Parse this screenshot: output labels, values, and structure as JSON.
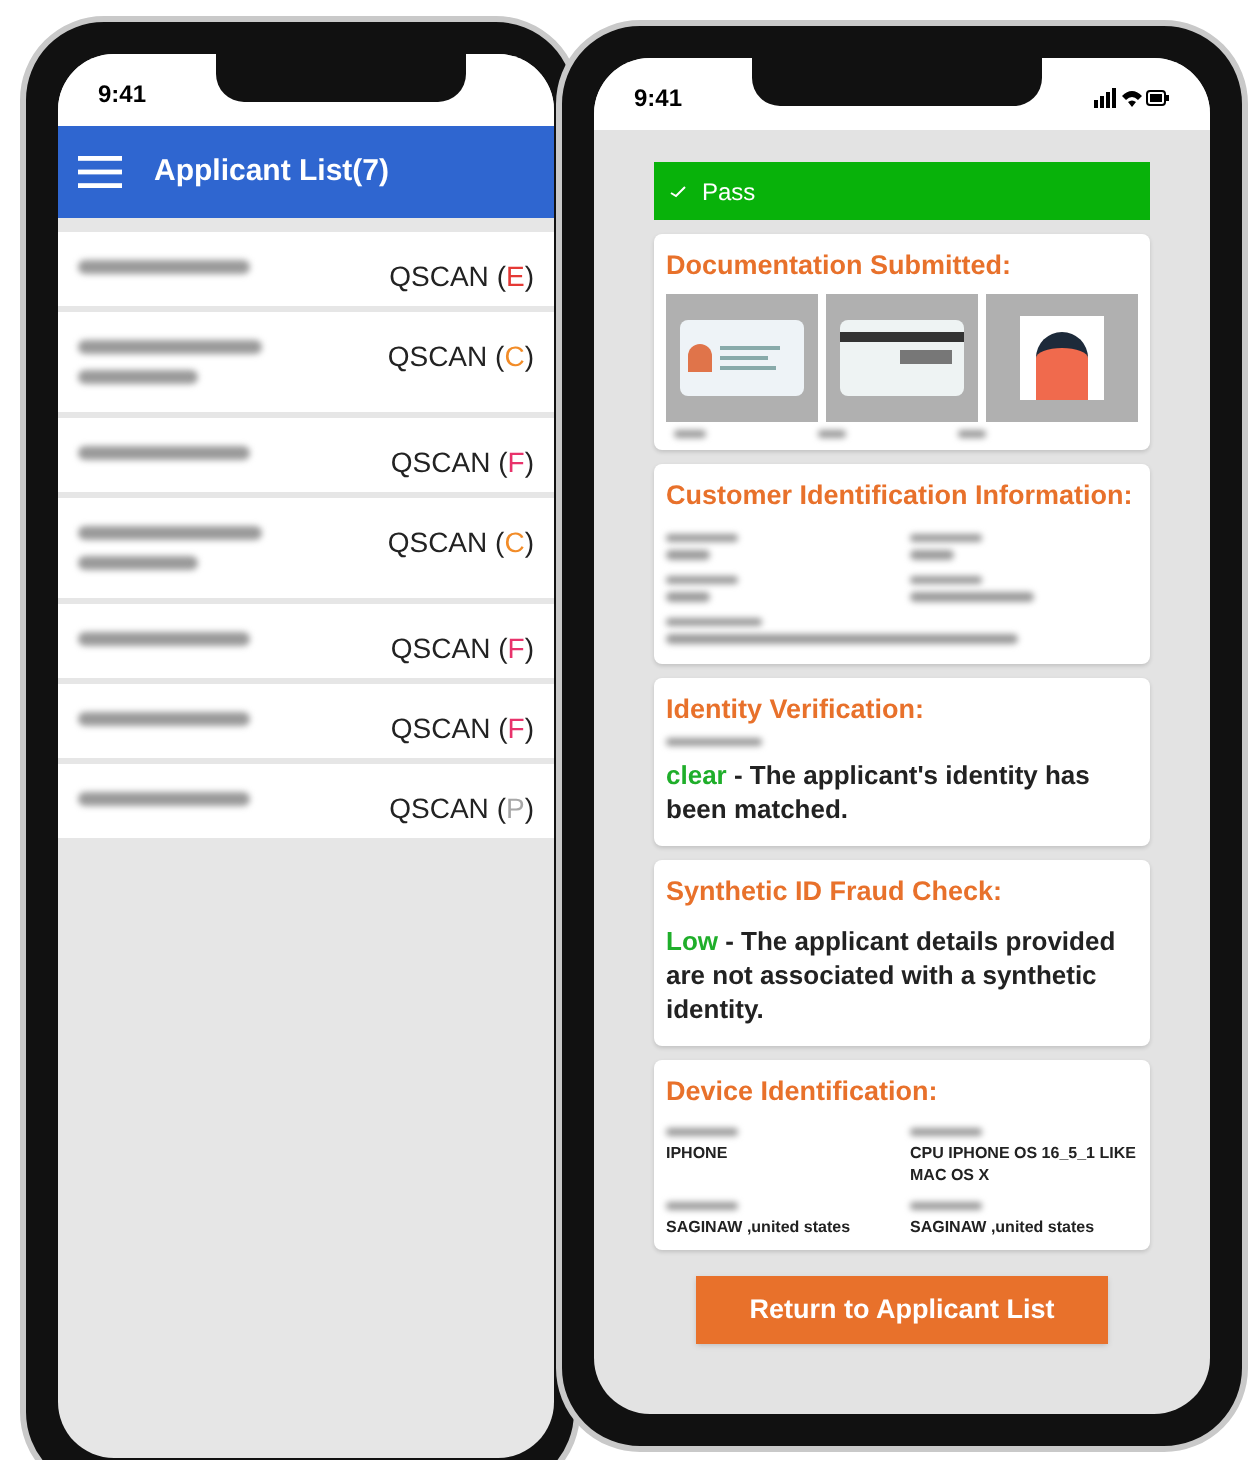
{
  "list_phone": {
    "time": "9:41",
    "header": {
      "title": "Applicant List(7)"
    },
    "applicants": [
      {
        "product": "QSCAN",
        "open": "(",
        "grade": ")",
        "code": "E",
        "color": "#e53935"
      },
      {
        "product": "QSCAN",
        "open": "(",
        "grade": ")",
        "code": "C",
        "color": "#f28c28"
      },
      {
        "product": "QSCAN",
        "open": "(",
        "grade": ")",
        "code": "F",
        "color": "#e8336b"
      },
      {
        "product": "QSCAN",
        "open": "(",
        "grade": ")",
        "code": "C",
        "color": "#f28c28"
      },
      {
        "product": "QSCAN",
        "open": "(",
        "grade": ")",
        "code": "F",
        "color": "#e8336b"
      },
      {
        "product": "QSCAN",
        "open": "(",
        "grade": ")",
        "code": "F",
        "color": "#e8336b"
      },
      {
        "product": "QSCAN",
        "open": "(",
        "grade": ")",
        "code": "P",
        "color": "#a8a8a8"
      }
    ]
  },
  "detail_phone": {
    "time": "9:41",
    "status_banner": {
      "label": "Pass"
    },
    "documentation": {
      "title": "Documentation Submitted:"
    },
    "customer_info": {
      "title": "Customer Identification Information:"
    },
    "identity": {
      "title": "Identity Verification:",
      "result": "clear",
      "description": " - The applicant's identity has been matched."
    },
    "synthetic": {
      "title": "Synthetic ID Fraud Check:",
      "result": "Low",
      "description": " - The applicant details provided are not associated with a synthetic identity."
    },
    "device": {
      "title": "Device Identification:",
      "fields": [
        {
          "value": "IPHONE"
        },
        {
          "value": "CPU IPHONE OS 16_5_1 LIKE MAC OS X"
        },
        {
          "value": "SAGINAW ,united states"
        },
        {
          "value": "SAGINAW ,united states"
        }
      ]
    },
    "return_button": {
      "label": "Return to Applicant List"
    }
  }
}
